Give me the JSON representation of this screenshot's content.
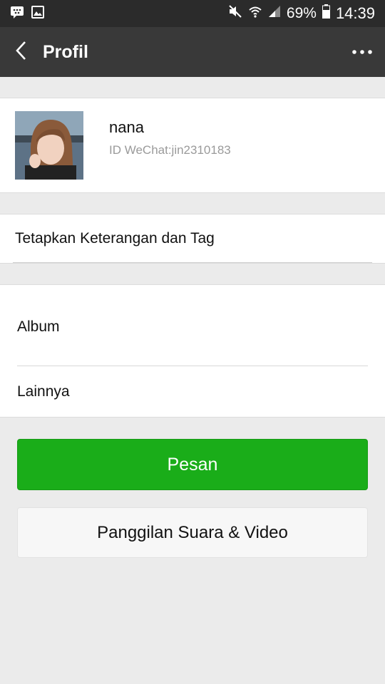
{
  "status_bar": {
    "battery": "69%",
    "time": "14:39",
    "icons": [
      "bbm-icon",
      "gallery-icon",
      "mute-icon",
      "wifi-icon",
      "signal-icon",
      "battery-icon"
    ]
  },
  "header": {
    "title": "Profil",
    "back_icon": "back-arrow-icon",
    "more_icon": "more-dots-icon"
  },
  "profile": {
    "name": "nana",
    "wechat_id": "ID WeChat:jin2310183"
  },
  "tag_row": {
    "label": "Tetapkan Keterangan dan Tag"
  },
  "menu": {
    "album_label": "Album",
    "more_label": "Lainnya"
  },
  "actions": {
    "message_label": "Pesan",
    "call_label": "Panggilan Suara & Video"
  },
  "colors": {
    "header_bg": "#393939",
    "status_bg": "#2b2b2b",
    "primary_green": "#1aad19",
    "page_bg": "#ebebeb"
  }
}
